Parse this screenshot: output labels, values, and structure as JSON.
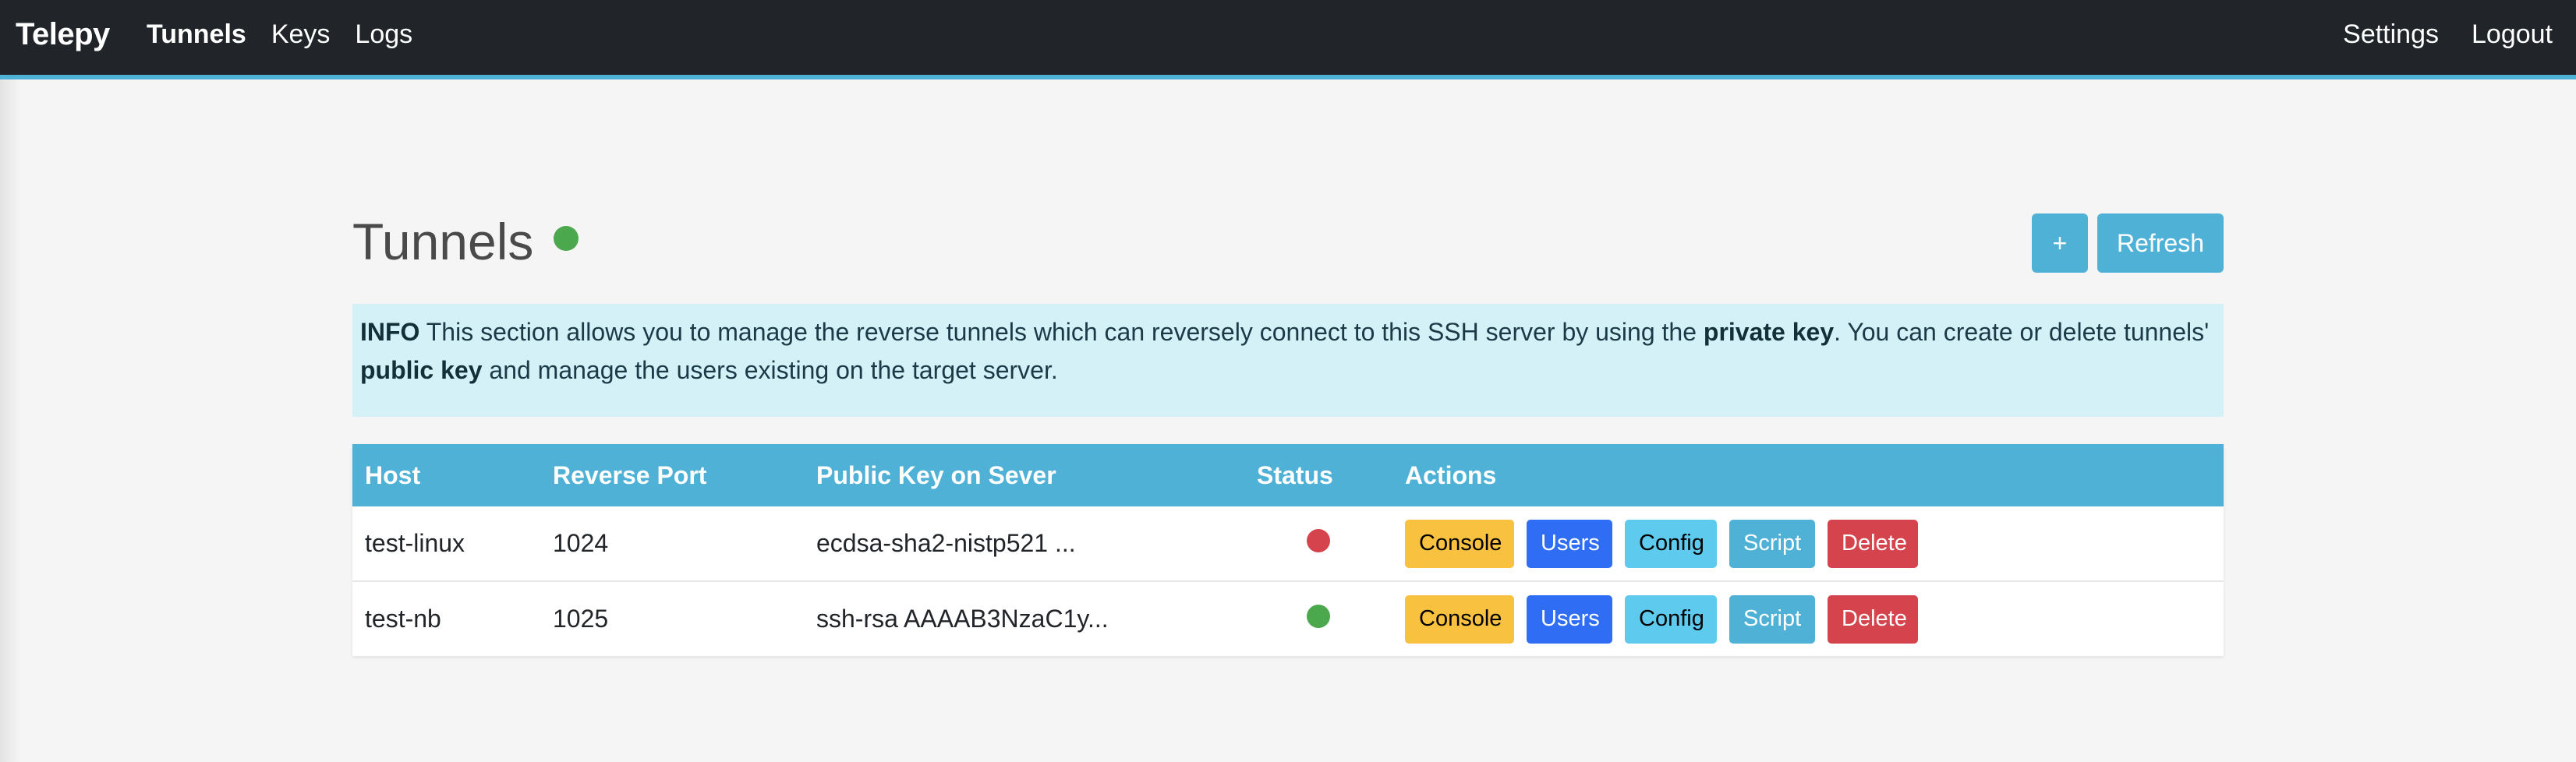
{
  "navbar": {
    "brand": "Telepy",
    "left_links": [
      "Tunnels",
      "Keys",
      "Logs"
    ],
    "active_link": "Tunnels",
    "right_links": [
      "Settings",
      "Logout"
    ],
    "accent_color": "#4fb1d6"
  },
  "page": {
    "title": "Tunnels",
    "status_color": "#4ca84c",
    "add_label": "+",
    "refresh_label": "Refresh"
  },
  "info": {
    "label": "INFO",
    "text1": " This section allows you to manage the reverse tunnels which can reversely connect to this SSH server by using the ",
    "bold1": "private key",
    "text2": ". You can create or delete tunnels' ",
    "bold2": "public key",
    "text3": " and manage the users existing on the target server."
  },
  "table": {
    "headers": [
      "Host",
      "Reverse Port",
      "Public Key on Sever",
      "Status",
      "Actions"
    ],
    "rows": [
      {
        "host": "test-linux",
        "port": "1024",
        "key": "ecdsa-sha2-nistp521 ...",
        "status": "offline",
        "status_color": "#d5444d"
      },
      {
        "host": "test-nb",
        "port": "1025",
        "key": "ssh-rsa AAAAB3NzaC1y...",
        "status": "online",
        "status_color": "#4ca84c"
      }
    ],
    "action_labels": {
      "console": "Console",
      "users": "Users",
      "config": "Config",
      "script": "Script",
      "delete": "Delete"
    }
  }
}
